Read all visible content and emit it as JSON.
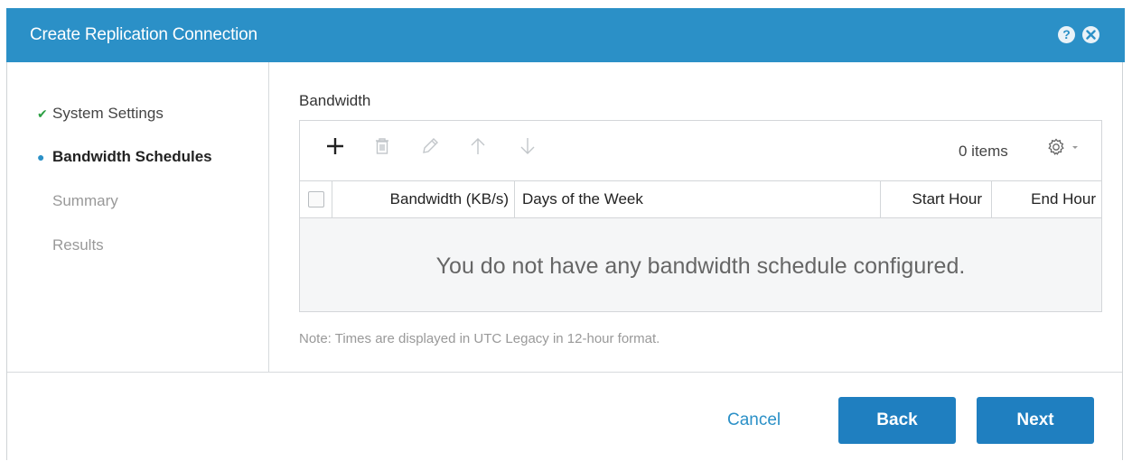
{
  "dialog": {
    "title": "Create Replication Connection",
    "icons": {
      "help": "question-circle-icon",
      "close": "close-circle-icon"
    }
  },
  "steps": [
    {
      "label": "System Settings",
      "state": "done",
      "icon": "checkmark-icon"
    },
    {
      "label": "Bandwidth Schedules",
      "state": "current",
      "icon": "bullet-icon"
    },
    {
      "label": "Summary",
      "state": "pending"
    },
    {
      "label": "Results",
      "state": "pending"
    }
  ],
  "bandwidth": {
    "section_title": "Bandwidth",
    "toolbar": {
      "add_icon": "plus-icon",
      "delete_icon": "trash-icon",
      "edit_icon": "pencil-icon",
      "up_icon": "arrow-up-icon",
      "down_icon": "arrow-down-icon",
      "items_count": "0 items",
      "settings_icon": "gear-icon"
    },
    "columns": [
      "Bandwidth (KB/s)",
      "Days of the Week",
      "Start Hour",
      "End Hour"
    ],
    "rows": [],
    "empty_message": "You do not have any bandwidth schedule configured.",
    "note": "Note: Times are displayed in UTC Legacy in 12-hour format."
  },
  "footer": {
    "cancel_label": "Cancel",
    "back_label": "Back",
    "next_label": "Next"
  },
  "colors": {
    "titlebar": "#2b90c7",
    "primary_button": "#1f7fc0",
    "success": "#2ca043"
  }
}
